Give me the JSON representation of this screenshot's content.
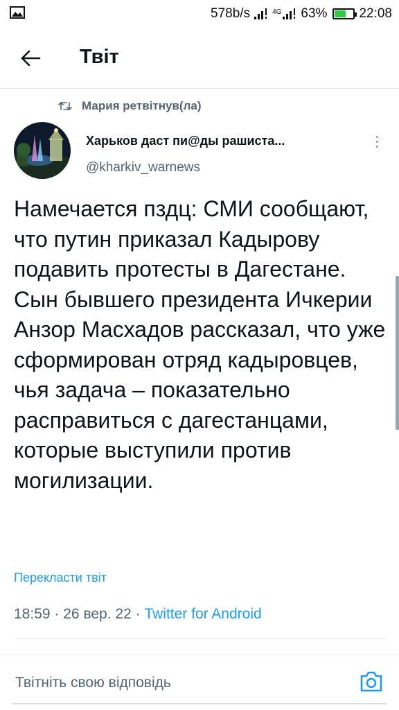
{
  "status_bar": {
    "net_speed": "578b/s",
    "signal_label": "4G",
    "battery_percent": "63%",
    "battery_level": 0.63,
    "time": "22:08",
    "icons": [
      "image-icon",
      "signal-icon",
      "battery-icon"
    ]
  },
  "header": {
    "back_icon": "arrow-left-icon",
    "title": "Твіт"
  },
  "retweet": {
    "icon": "retweet-icon",
    "text": "Мария ретвітнув(ла)"
  },
  "author": {
    "name": "Харьков даст пи@ды рашиста...",
    "handle": "@kharkiv_warnews"
  },
  "tweet": {
    "text": "Намечается пздц: СМИ сообщают, что путин приказал Кадырову подавить протесты в Дагестане. Сын бывшего президента Ичкерии Анзор Масхадов рассказал, что уже сформирован отряд кадыровцев, чья задача – показательно расправиться с дагестанцами, которые выступили против могилизации.",
    "translate_label": "Перекласти твіт",
    "time": "18:59",
    "separator": "·",
    "date": "26 вер. 22",
    "client": "Twitter for Android"
  },
  "reply": {
    "placeholder": "Твітніть свою відповідь",
    "camera_icon": "camera-icon"
  },
  "colors": {
    "accent": "#1d9bf0",
    "secondary_text": "#536471",
    "battery_fill": "#2ecc40"
  }
}
